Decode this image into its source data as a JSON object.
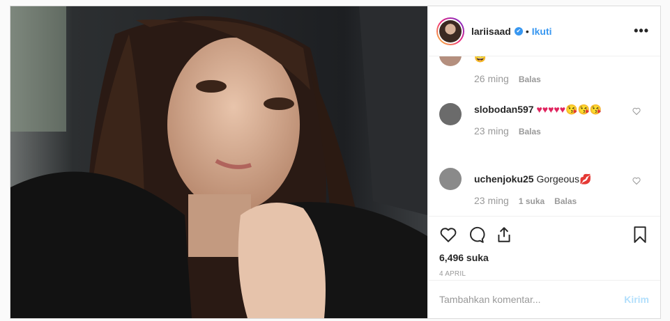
{
  "header": {
    "username": "lariisaad",
    "verified_mark": "✔",
    "separator": "•",
    "follow_label": "Ikuti",
    "more_label": "•••"
  },
  "comments": [
    {
      "user": "",
      "text": "😄",
      "time": "26 ming",
      "likes": "",
      "reply": "Balas"
    },
    {
      "user": "slobodan597",
      "text": "♥♥♥♥♥😘😘😘",
      "time": "23 ming",
      "likes": "",
      "reply": "Balas"
    },
    {
      "user": "uchenjoku25",
      "text": "Gorgeous💋",
      "time": "23 ming",
      "likes": "1 suka",
      "reply": "Balas"
    }
  ],
  "post": {
    "likes": "6,496 suka",
    "date": "4 APRIL"
  },
  "composer": {
    "placeholder": "Tambahkan komentar...",
    "send_label": "Kirim"
  },
  "icons": [
    "heart-icon",
    "comment-icon",
    "share-icon",
    "bookmark-icon",
    "verified-badge-icon",
    "more-icon"
  ],
  "colors": {
    "accent": "#3897f0",
    "send_disabled": "#b2dffc",
    "muted": "#999999"
  }
}
